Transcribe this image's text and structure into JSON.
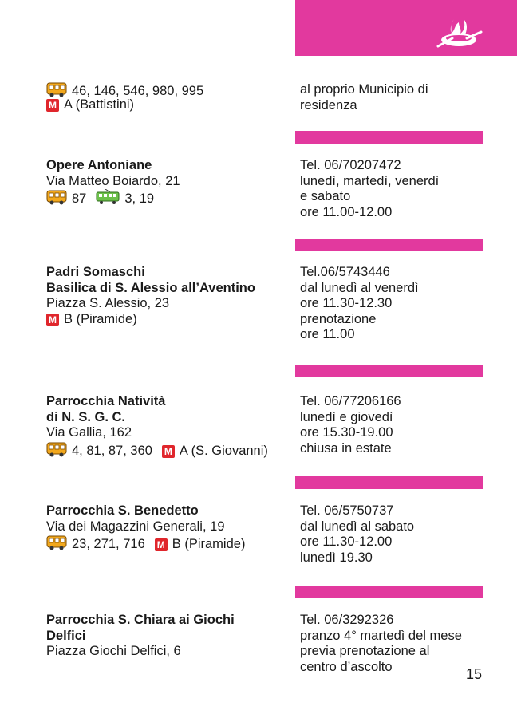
{
  "icons": {
    "bus": "bus-icon",
    "tram": "tram-icon",
    "metro": "metro-icon",
    "metro_letter": "M",
    "logo": "pot-flame-logo"
  },
  "colors": {
    "accent": "#e2399e",
    "metro": "#e0262c",
    "text": "#1a1a1a"
  },
  "entries": [
    {
      "bus": "46, 146, 546, 980, 995",
      "metro": "A (Battistini)",
      "right": [
        "al proprio Municipio di",
        "residenza"
      ]
    },
    {
      "name": [
        "Opere Antoniane"
      ],
      "address": "Via Matteo Boiardo, 21",
      "bus": "87",
      "tram": "3, 19",
      "right": [
        "Tel. 06/70207472",
        "lunedì, martedì, venerdì",
        "e sabato",
        "ore 11.00-12.00"
      ]
    },
    {
      "name": [
        "Padri Somaschi",
        "Basilica di S. Alessio all’Aventino"
      ],
      "address": "Piazza S. Alessio, 23",
      "metro": "B (Piramide)",
      "right": [
        "Tel.06/5743446",
        "dal lunedì al venerdì",
        "ore 11.30-12.30",
        "prenotazione",
        "ore 11.00"
      ]
    },
    {
      "name": [
        "Parrocchia Natività",
        "di N. S. G. C."
      ],
      "address": "Via Gallia, 162",
      "bus": "4, 81, 87, 360",
      "metro": "A (S. Giovanni)",
      "right": [
        "Tel. 06/77206166",
        "lunedì e giovedì",
        "ore 15.30-19.00",
        "chiusa in estate"
      ]
    },
    {
      "name": [
        "Parrocchia S. Benedetto"
      ],
      "address": "Via dei Magazzini Generali, 19",
      "bus": "23, 271, 716",
      "metro": "B (Piramide)",
      "right": [
        "Tel. 06/5750737",
        "dal lunedì al sabato",
        "ore 11.30-12.00",
        "lunedì 19.30"
      ]
    },
    {
      "name": [
        "Parrocchia S. Chiara ai Giochi",
        "Delfici"
      ],
      "address": "Piazza Giochi Delfici, 6",
      "right": [
        "Tel. 06/3292326",
        "pranzo 4° martedì del mese",
        "previa prenotazione al",
        "centro d’ascolto"
      ]
    }
  ],
  "page_number": "15"
}
